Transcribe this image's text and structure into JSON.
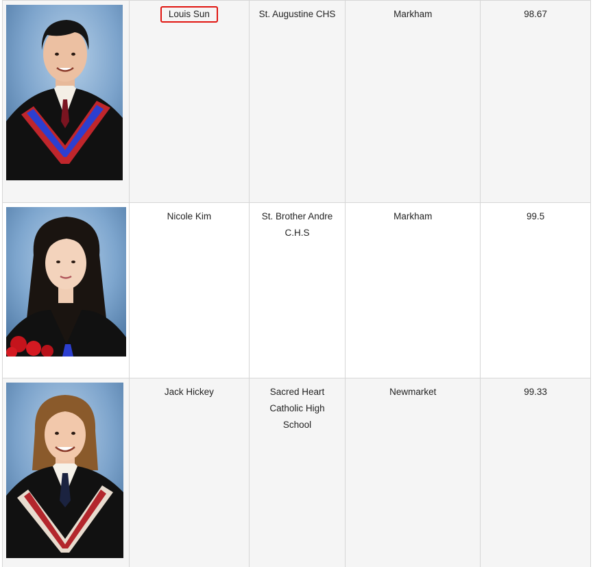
{
  "rows": [
    {
      "photo": {
        "icon": "graduate-portrait-boy-icon",
        "gown_color": "#111111",
        "stole_outer": "#c0262c",
        "stole_inner": "#2c3fd0",
        "hair_color": "#141414"
      },
      "name": "Louis Sun",
      "school": "St. Augustine CHS",
      "city": "Markham",
      "average": "98.67"
    },
    {
      "photo": {
        "icon": "graduate-portrait-girl-icon",
        "gown_color": "#111111",
        "stole_outer": "#c0262c",
        "stole_inner": "#2c3fd0",
        "hair_color": "#1a1410"
      },
      "name": "Nicole Kim",
      "school": "St. Brother Andre C.H.S",
      "city": "Markham",
      "average": "99.5"
    },
    {
      "photo": {
        "icon": "graduate-portrait-boy-long-hair-icon",
        "gown_color": "#111111",
        "stole_outer": "#e8dccf",
        "stole_inner": "#b3262c",
        "hair_color": "#8a5a2b"
      },
      "name": "Jack Hickey",
      "school": "Sacred Heart Catholic High School",
      "city": "Newmarket",
      "average": "99.33"
    }
  ]
}
